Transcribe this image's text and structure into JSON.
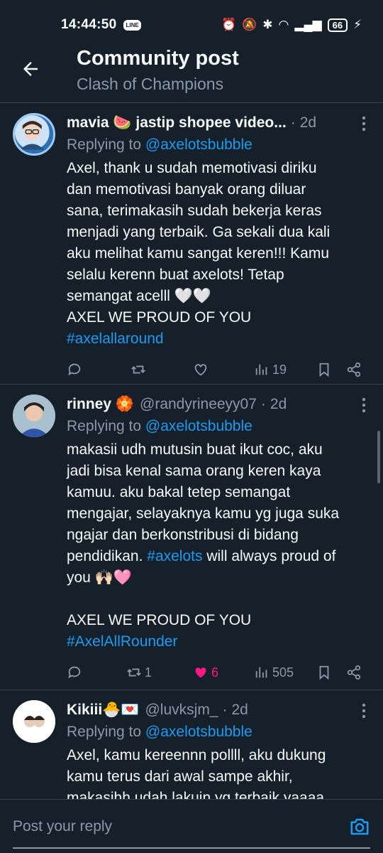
{
  "status_bar": {
    "time": "14:44:50",
    "line_badge": "LINE",
    "battery": "66"
  },
  "header": {
    "title": "Community post",
    "subtitle": "Clash of Champions"
  },
  "tweets": [
    {
      "name": "mavia 🍉 jastip shopee video...",
      "handle": "",
      "time": "2d",
      "replying_prefix": "Replying to",
      "replying_mention": "@axelotsbubble",
      "body_lines": [
        "Axel, thank u sudah memotivasi diriku",
        "dan memotivasi banyak orang diluar",
        "sana, terimakasih sudah bekerja keras",
        "menjadi yang terbaik. Ga sekali dua kali",
        "aku melihat kamu sangat keren!!! Kamu",
        "selalu kerenn buat axelots! Tetap",
        "semangat acelll 🤍🤍",
        "AXEL WE PROUD OF YOU"
      ],
      "hashtag_line": "#axelallaround",
      "retweets": "",
      "likes": "",
      "views": "19"
    },
    {
      "name": "rinney 🏵️",
      "handle": "@randyrineeyy07",
      "time": "2d",
      "replying_prefix": "Replying to",
      "replying_mention": "@axelotsbubble",
      "body_lines": [
        "makasii udh mutusin buat ikut coc, aku",
        "jadi bisa kenal sama orang keren kaya",
        "kamuu. aku bakal tetep semangat",
        "mengajar, selayaknya kamu yg juga suka",
        "ngajar dan berkonstribusi di bidang"
      ],
      "line6_pre": "pendidikan. ",
      "line6_tag": "#axelots",
      "line6_post": " will always proud of",
      "line7": "you 🙌🏻🩷",
      "line8": "",
      "line9": "AXEL WE PROUD OF YOU",
      "hashtag_line": "#AxelAllRounder",
      "retweets": "1",
      "likes": "6",
      "views": "505"
    },
    {
      "name": "Kikiii🐣💌",
      "handle": "@luvksjm_",
      "time": "2d",
      "replying_prefix": "Replying to",
      "replying_mention": "@axelotsbubble",
      "body_lines": [
        "Axel, kamu kereennn pollll, aku dukung",
        "kamu terus dari awal sampe akhir,",
        "makasihh udah lakuin yg terbaik yaaaa"
      ]
    }
  ],
  "reply_bar": {
    "placeholder": "Post your reply"
  },
  "colors": {
    "background": "#15202b",
    "accent": "#1d9bf0",
    "like": "#f91880",
    "muted": "#8b98a5",
    "divider": "#38444d"
  }
}
